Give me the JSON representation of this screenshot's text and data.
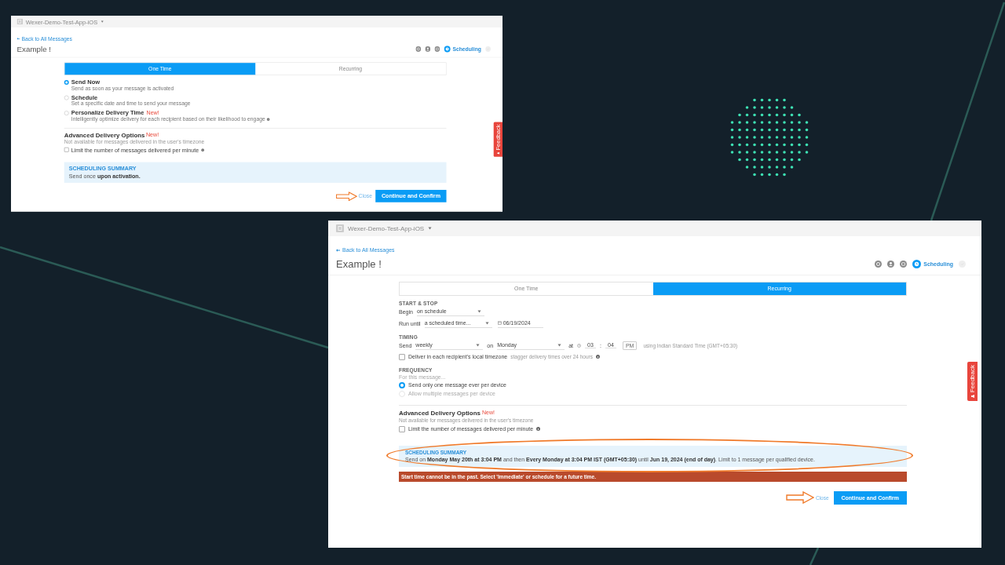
{
  "slide": {
    "screenshots": [
      {
        "app_name": "Wexer-Demo-Test-App-iOS",
        "back_link": "Back to All Messages",
        "title": "Example !",
        "steps": [
          {
            "kind": "settings",
            "selected": false,
            "disabled": false
          },
          {
            "kind": "audience",
            "selected": false,
            "disabled": false
          },
          {
            "kind": "message",
            "selected": false,
            "disabled": false
          },
          {
            "kind": "schedule",
            "selected": true,
            "disabled": false,
            "label": "Scheduling"
          },
          {
            "kind": "review",
            "selected": false,
            "disabled": true
          }
        ],
        "tabs": [
          {
            "label": "One Time",
            "selected": true
          },
          {
            "label": "Recurring",
            "selected": false
          }
        ],
        "sections": [
          {
            "kind": "plain",
            "blocks": [
              {
                "kind": "radio",
                "label": "Send Now",
                "description": "Send as soon as your message is activated",
                "selected": true
              },
              {
                "kind": "radio",
                "label": "Schedule",
                "description": "Set a specific date and time to send your message",
                "selected": false
              },
              {
                "kind": "radio",
                "label": "Personalize Delivery Time",
                "badge": "New!",
                "description": "Intelligently optimize delivery for each recipient based on their likelihood to engage",
                "info": true,
                "selected": false
              }
            ]
          },
          {
            "kind": "advanced",
            "heading": "Advanced Delivery Options",
            "badge": "New!",
            "note": "Not available for messages delivered in the user's timezone",
            "blocks": [
              {
                "kind": "checkbox",
                "label": "Limit the number of messages delivered per minute",
                "info": true,
                "checked": false
              }
            ]
          }
        ],
        "summary": {
          "heading": "SCHEDULING SUMMARY",
          "text": "Send once **upon activation.**",
          "highlighted": false
        },
        "buttons": {
          "close": "Close",
          "confirm": "Continue and Confirm"
        },
        "arrow_annotation": true,
        "feedback": "Feedback"
      },
      {
        "app_name": "Wexer-Demo-Test-App-iOS",
        "back_link": "Back to All Messages",
        "title": "Example !",
        "steps": [
          {
            "kind": "settings",
            "selected": false,
            "disabled": false
          },
          {
            "kind": "audience",
            "selected": false,
            "disabled": false
          },
          {
            "kind": "message",
            "selected": false,
            "disabled": false
          },
          {
            "kind": "schedule",
            "selected": true,
            "disabled": false,
            "label": "Scheduling"
          },
          {
            "kind": "review",
            "selected": false,
            "disabled": true
          }
        ],
        "tabs": [
          {
            "label": "One Time",
            "selected": false
          },
          {
            "label": "Recurring",
            "selected": true
          }
        ],
        "sections": [
          {
            "kind": "plain",
            "heading": "START & STOP",
            "blocks": [
              {
                "kind": "row",
                "items": [
                  {
                    "kind": "label",
                    "text": "Begin"
                  },
                  {
                    "kind": "select",
                    "value": "on schedule"
                  }
                ]
              },
              {
                "kind": "row",
                "items": [
                  {
                    "kind": "label",
                    "text": "Run until"
                  },
                  {
                    "kind": "select",
                    "value": "a scheduled time..."
                  },
                  {
                    "kind": "date",
                    "value": "06/19/2024"
                  }
                ]
              }
            ]
          },
          {
            "kind": "plain",
            "heading": "TIMING",
            "blocks": [
              {
                "kind": "row",
                "items": [
                  {
                    "kind": "label",
                    "text": "Send"
                  },
                  {
                    "kind": "select",
                    "value": "weekly"
                  },
                  {
                    "kind": "label",
                    "text": "on"
                  },
                  {
                    "kind": "select",
                    "value": "Monday"
                  },
                  {
                    "kind": "label",
                    "text": "at"
                  },
                  {
                    "kind": "time",
                    "hour": "03",
                    "separator": ":",
                    "minute": "04",
                    "period": "PM"
                  },
                  {
                    "kind": "note",
                    "text": "using Indian Standard Time (GMT+05:30)"
                  }
                ]
              },
              {
                "kind": "checkbox",
                "label": "Deliver in each recipient's local timezone",
                "note": "stagger delivery times over 24 hours",
                "info": true,
                "checked": false
              }
            ]
          },
          {
            "kind": "plain",
            "heading": "FREQUENCY",
            "blocks": [
              {
                "kind": "hint",
                "text": "For this message..."
              },
              {
                "kind": "radio",
                "label": "Send only one message ever per device",
                "selected": true,
                "disabled": false
              },
              {
                "kind": "radio",
                "label": "Allow multiple messages per device",
                "selected": false,
                "disabled": true
              }
            ]
          },
          {
            "kind": "advanced",
            "heading": "Advanced Delivery Options",
            "badge": "New!",
            "note": "Not available for messages delivered in the user's timezone",
            "blocks": [
              {
                "kind": "checkbox",
                "label": "Limit the number of messages delivered per minute",
                "info": true,
                "checked": false
              }
            ]
          }
        ],
        "summary": {
          "heading": "SCHEDULING SUMMARY",
          "text": "Send on **Monday May 20th at 3:04 PM** and then **Every Monday at 3:04 PM IST (GMT+05:30)** until **Jun 19, 2024 (end of day)**. Limit to 1 message per qualified device.",
          "highlighted": true
        },
        "error": "Start time cannot be in the past. Select 'Immediate' or schedule for a future time.",
        "buttons": {
          "close": "Close",
          "confirm": "Continue and Confirm"
        },
        "arrow_annotation": true,
        "feedback": "Feedback"
      }
    ]
  }
}
